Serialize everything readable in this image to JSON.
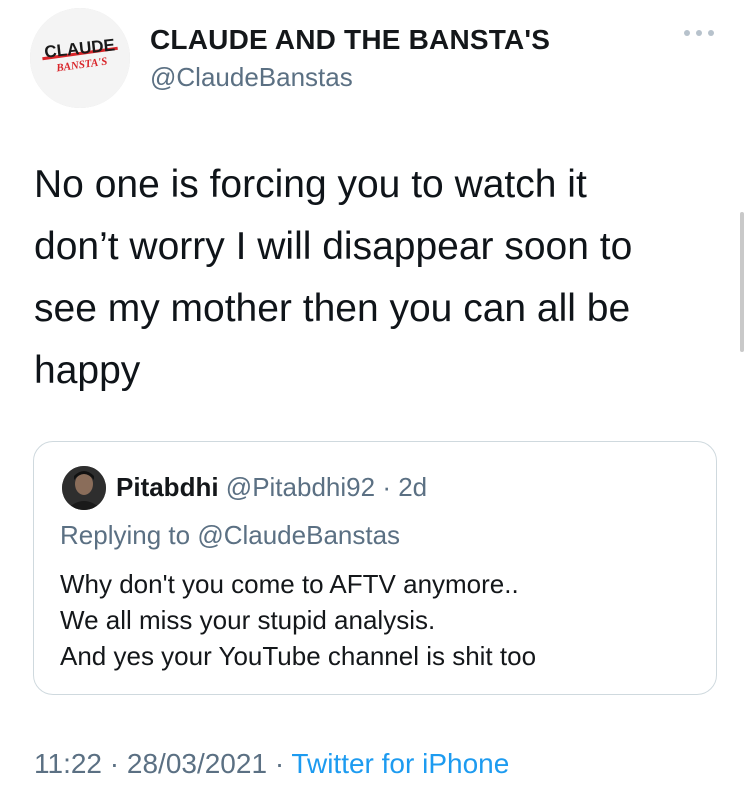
{
  "author": {
    "display_name": "CLAUDE AND THE BANSTA'S",
    "handle": "@ClaudeBanstas",
    "avatar_logo_text": "CLAUDE",
    "avatar_logo_subtext": "BANSTA'S"
  },
  "tweet": {
    "text_lines": [
      "No one is forcing you to watch it",
      "don’t worry I will disappear soon to",
      "see my mother then you can all be",
      "happy"
    ],
    "time": "11:22",
    "date": "28/03/2021",
    "source": "Twitter for iPhone"
  },
  "quoted": {
    "name": "Pitabdhi",
    "handle": "@Pitabdhi92",
    "age": "2d",
    "replying_label": "Replying to",
    "replying_to": "@ClaudeBanstas",
    "text_lines": [
      "Why don't you come to AFTV anymore..",
      "We all miss your stupid analysis.",
      "And yes your YouTube channel is shit too"
    ]
  },
  "icons": {
    "more": "more-horizontal-icon"
  },
  "colors": {
    "accent": "#1d9bf0",
    "secondary_text": "#5b7083",
    "border": "#cfd9de",
    "logo_red": "#d9252a"
  }
}
